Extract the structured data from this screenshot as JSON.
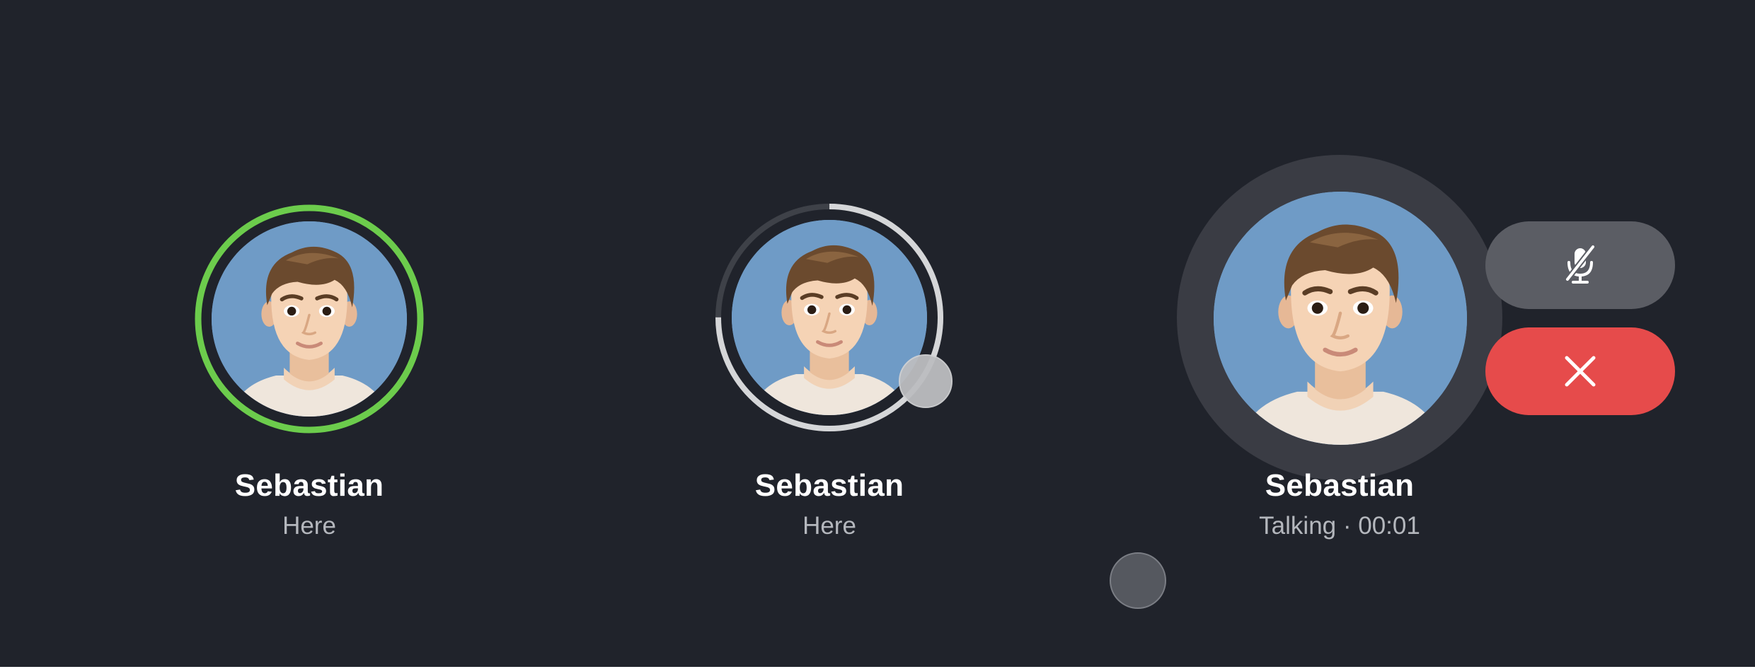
{
  "contacts": [
    {
      "name": "Sebastian",
      "status": "Here",
      "ring": "green",
      "ring_progress": 1.0
    },
    {
      "name": "Sebastian",
      "status": "Here",
      "ring": "loading",
      "ring_progress": 0.75
    },
    {
      "name": "Sebastian",
      "status": "Talking · 00:01",
      "ring": "none"
    }
  ],
  "controls": {
    "mute_icon": "mic-off-icon",
    "end_icon": "close-icon"
  },
  "colors": {
    "background": "#20232b",
    "ring_active": "#6ccc4c",
    "ring_track": "#3e4148",
    "ring_progress": "#d5d6d8",
    "avatar_bg": "#6f9bc6",
    "halo": "#3a3c44",
    "mute_button": "#5b5d64",
    "end_button": "#e64b4b",
    "name_text": "#ffffff",
    "status_text": "#b4b7bd"
  }
}
